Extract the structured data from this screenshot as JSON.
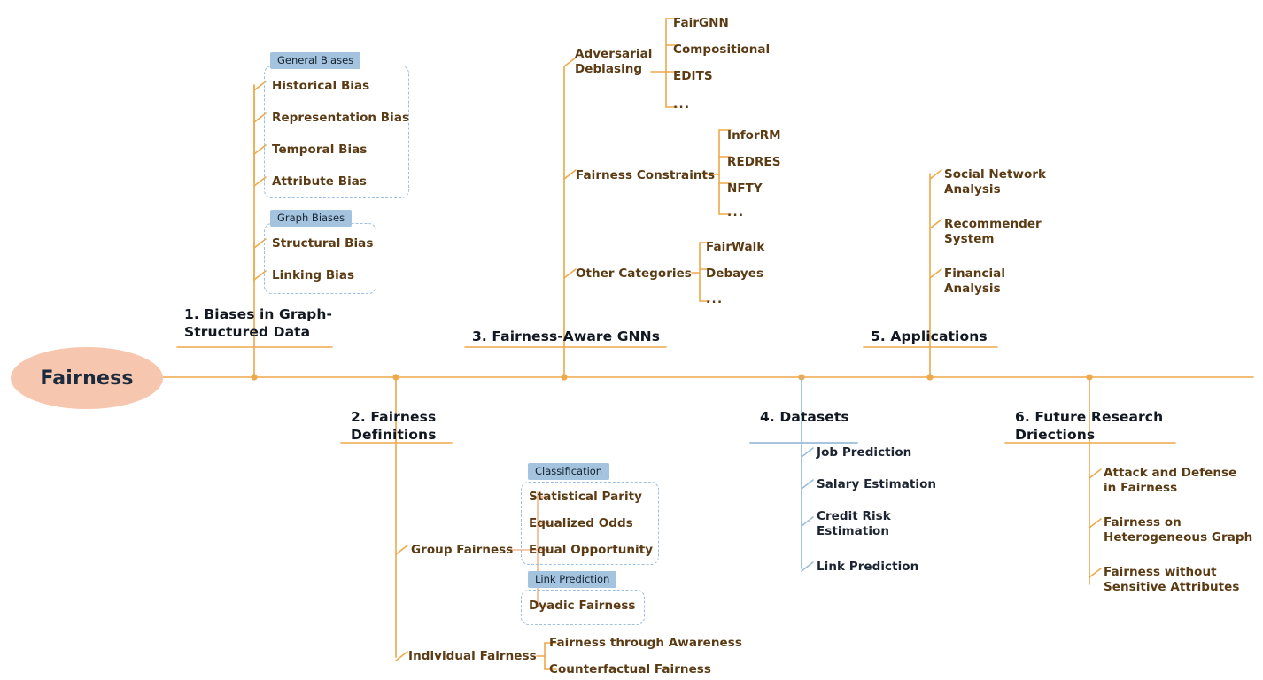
{
  "diagram": {
    "title": "Fairness in Graph Neural Networks taxonomy mind map",
    "root": {
      "label": "Fairness"
    },
    "colors": {
      "root_fill": "#f7c6ae",
      "root_text": "#1b2a3d",
      "trunk": "#eda94a",
      "branch_orange": "#eda94a",
      "branch_blue": "#9bbdd8",
      "leaf_spine_salmon": "#f2b58e",
      "node_text": "#5b3b14",
      "title_text": "#111822",
      "tab_fill": "#a4c3de",
      "tab_text": "#16222f",
      "dashed_border": "#9fc0dc"
    },
    "branches": [
      {
        "id": "biases",
        "title": "1. Biases in Graph-\nStructured Data",
        "groups": [
          {
            "tab": "General Biases",
            "items": [
              "Historical Bias",
              "Representation Bias",
              "Temporal Bias",
              "Attribute Bias"
            ]
          },
          {
            "tab": "Graph Biases",
            "items": [
              "Structural Bias",
              "Linking Bias"
            ]
          }
        ]
      },
      {
        "id": "definitions",
        "title": "2. Fairness\nDefinitions",
        "categories": [
          {
            "label": "Group Fairness",
            "groups": [
              {
                "tab": "Classification",
                "items": [
                  "Statistical Parity",
                  "Equalized Odds",
                  "Equal Opportunity"
                ]
              },
              {
                "tab": "Link Prediction",
                "items": [
                  "Dyadic Fairness"
                ]
              }
            ]
          },
          {
            "label": "Individual Fairness",
            "items": [
              "Fairness through Awareness",
              "Counterfactual Fairness"
            ]
          }
        ]
      },
      {
        "id": "fair-gnns",
        "title": "3. Fairness-Aware GNNs",
        "categories": [
          {
            "label": "Adversarial\nDebiasing",
            "items": [
              "FairGNN",
              "Compositional",
              "EDITS",
              "..."
            ]
          },
          {
            "label": "Fairness Constraints",
            "items": [
              "InforRM",
              "REDRES",
              "NFTY",
              "..."
            ]
          },
          {
            "label": "Other Categories",
            "items": [
              "FairWalk",
              "Debayes",
              "..."
            ]
          }
        ]
      },
      {
        "id": "datasets",
        "title": "4. Datasets",
        "items": [
          "Job Prediction",
          "Salary Estimation",
          "Credit Risk\nEstimation",
          "Link Prediction"
        ]
      },
      {
        "id": "applications",
        "title": "5. Applications",
        "items": [
          "Social Network\nAnalysis",
          "Recommender\nSystem",
          "Financial\nAnalysis"
        ]
      },
      {
        "id": "future",
        "title": "6. Future Research\nDriections",
        "items": [
          "Attack and Defense\nin Fairness",
          "Fairness on\nHeterogeneous Graph",
          "Fairness without\nSensitive Attributes"
        ]
      }
    ]
  }
}
